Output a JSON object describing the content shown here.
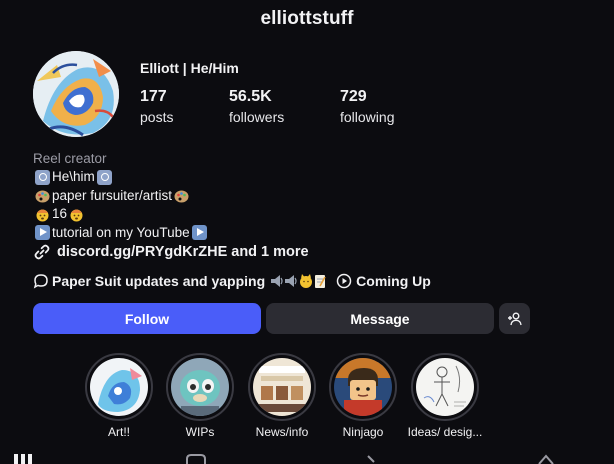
{
  "profile": {
    "username": "elliottstuff",
    "display_name": "Elliott | He/Him"
  },
  "stats": {
    "posts": {
      "value": "177",
      "label": "posts"
    },
    "followers": {
      "value": "56.5K",
      "label": "followers"
    },
    "following": {
      "value": "729",
      "label": "following"
    }
  },
  "bio": {
    "category": "Reel creator",
    "line1": "He\\him",
    "line2": "paper fursuiter/artist",
    "line3": "16",
    "line4": "tutorial on my YouTube"
  },
  "link": {
    "url": "discord.gg/PRYgdKrZHE",
    "more": "and 1 more"
  },
  "channels": {
    "channel1": "Paper Suit updates and yapping",
    "channel2": "Coming Up"
  },
  "buttons": {
    "follow": "Follow",
    "message": "Message"
  },
  "highlights": [
    {
      "title": "Art!!"
    },
    {
      "title": "WIPs"
    },
    {
      "title": "News/info"
    },
    {
      "title": "Ninjago"
    },
    {
      "title": "Ideas/ desig..."
    }
  ],
  "colors": {
    "background": "#0c0c10",
    "follow_button": "#4a5df9",
    "secondary_button": "#2c2c33"
  }
}
